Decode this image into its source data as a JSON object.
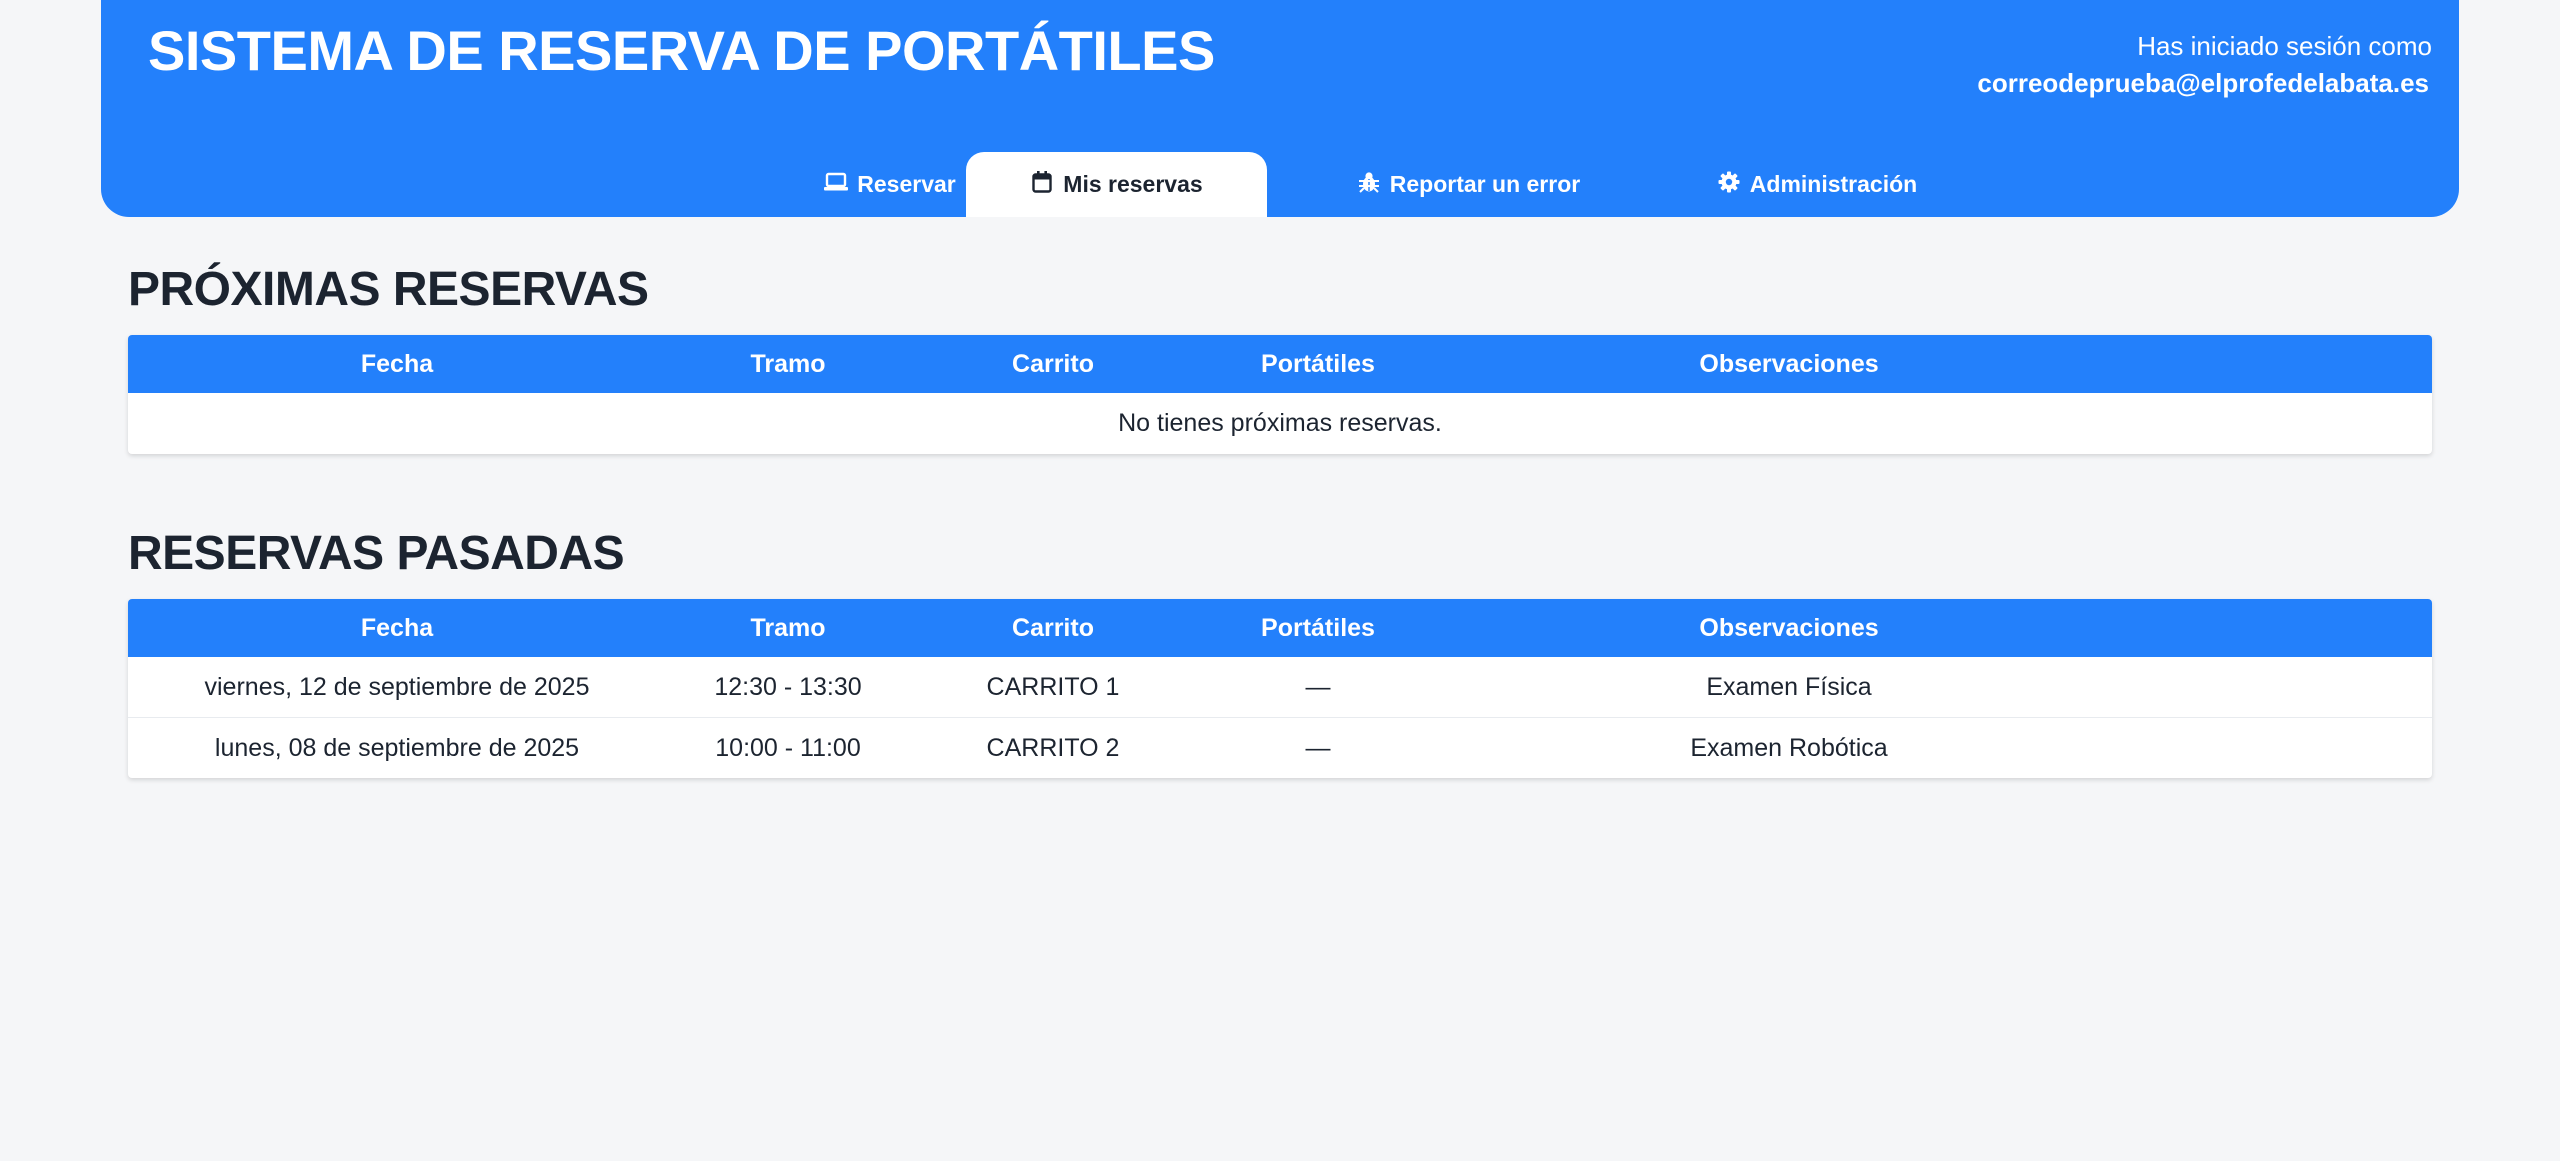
{
  "app": {
    "title": "SISTEMA DE RESERVA DE PORTÁTILES",
    "session_label": "Has iniciado sesión como",
    "session_email": "correodeprueba@elprofedelabata.es"
  },
  "tabs": [
    {
      "label": "Reservar",
      "icon": "laptop-icon",
      "active": false
    },
    {
      "label": "Mis reservas",
      "icon": "calendar-icon",
      "active": true
    },
    {
      "label": "Reportar un error",
      "icon": "bug-icon",
      "active": false
    },
    {
      "label": "Administración",
      "icon": "gear-icon",
      "active": false
    }
  ],
  "columns": [
    "Fecha",
    "Tramo",
    "Carrito",
    "Portátiles",
    "Observaciones"
  ],
  "upcoming": {
    "title": "PRÓXIMAS RESERVAS",
    "empty_message": "No tienes próximas reservas."
  },
  "past": {
    "title": "RESERVAS PASADAS",
    "rows": [
      {
        "fecha": "viernes, 12 de septiembre de 2025",
        "tramo": "12:30 - 13:30",
        "carrito": "CARRITO 1",
        "portatiles": "—",
        "observaciones": "Examen Física"
      },
      {
        "fecha": "lunes, 08 de septiembre de 2025",
        "tramo": "10:00 - 11:00",
        "carrito": "CARRITO 2",
        "portatiles": "—",
        "observaciones": "Examen Robótica"
      }
    ]
  },
  "colors": {
    "primary": "#2380fb",
    "background": "#f5f6f8",
    "text": "#1c2430"
  }
}
